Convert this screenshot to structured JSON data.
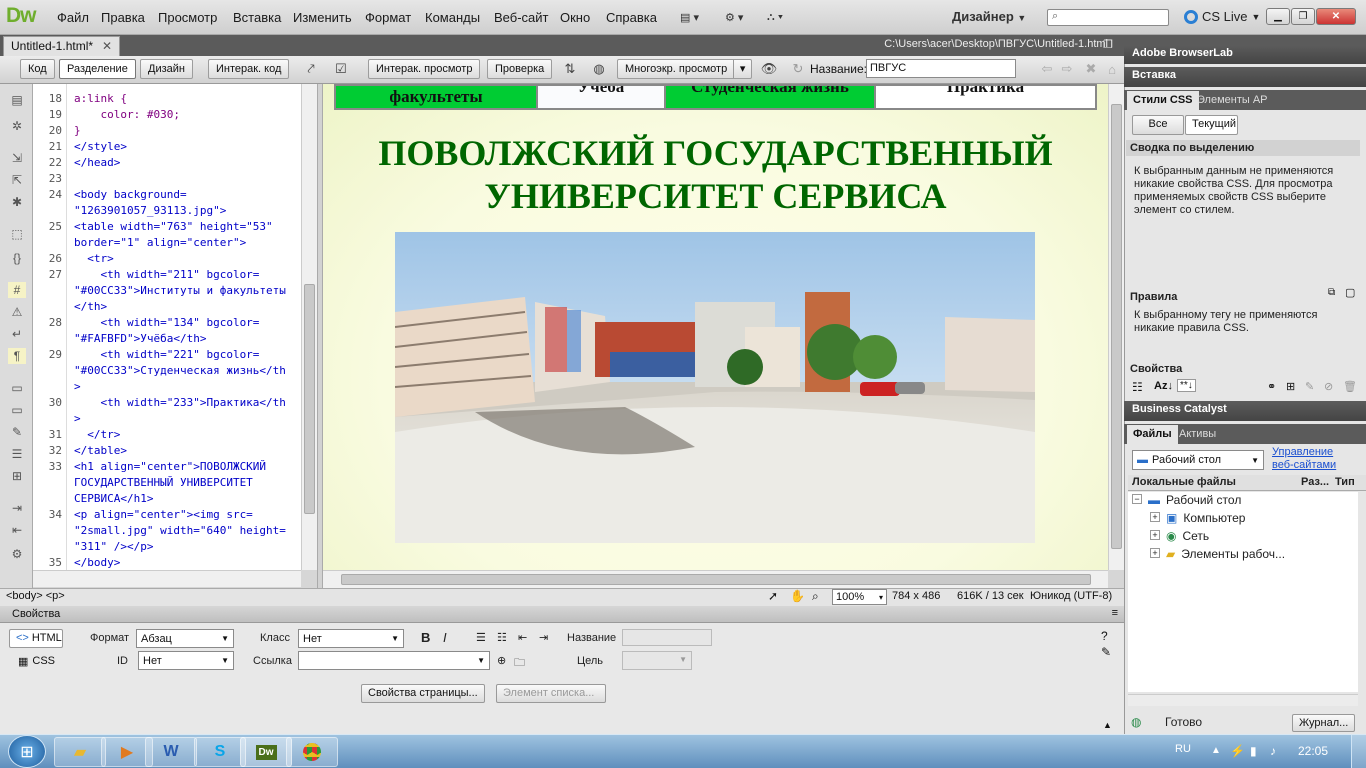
{
  "app": {
    "logo": "Dw"
  },
  "menu": [
    "Файл",
    "Правка",
    "Просмотр",
    "Вставка",
    "Изменить",
    "Формат",
    "Команды",
    "Веб-сайт",
    "Окно",
    "Справка"
  ],
  "workspace": {
    "label": "Дизайнер",
    "live": "CS Live"
  },
  "document": {
    "tab": "Untitled-1.html*",
    "path": "C:\\Users\\acer\\Desktop\\ПВГУС\\Untitled-1.html"
  },
  "toolbar": {
    "code": "Код",
    "split": "Разделение",
    "design": "Дизайн",
    "live_code": "Интерак. код",
    "live_view": "Интерак. просмотр",
    "inspect": "Проверка",
    "multiscreen": "Многоэкр. просмотр",
    "title_label": "Название:",
    "title_value": "ПВГУС"
  },
  "code": {
    "line_numbers": [
      "18",
      "19",
      "20",
      "21",
      "22",
      "23",
      "24",
      "",
      "25",
      "",
      "26",
      "27",
      "",
      "",
      "28",
      "",
      "29",
      "",
      "",
      "30",
      "",
      "31",
      "32",
      "33",
      "",
      "",
      "34",
      "",
      "",
      "35"
    ],
    "lines": [
      "a:link {",
      "    color: #030;",
      "}",
      "</style>",
      "</head>",
      "",
      "<body background=",
      "\"1263901057_93113.jpg\">",
      "<table width=\"763\" height=\"53\"",
      "border=\"1\" align=\"center\">",
      "  <tr>",
      "    <th width=\"211\" bgcolor=",
      "\"#00CC33\">Институты и факультеты",
      "</th>",
      "    <th width=\"134\" bgcolor=",
      "\"#FAFBFD\">Учёба</th>",
      "    <th width=\"221\" bgcolor=",
      "\"#00CC33\">Студенческая жизнь</th",
      ">",
      "    <th width=\"233\">Практика</th",
      ">",
      "  </tr>",
      "</table>",
      "<h1 align=\"center\">ПОВОЛЖСКИЙ",
      "ГОСУДАРСТВЕННЫЙ УНИВЕРСИТЕТ",
      "СЕРВИСА</h1>",
      "<p align=\"center\"><img src=",
      "\"2small.jpg\" width=\"640\" height=",
      "\"311\" /></p>",
      "</body>"
    ]
  },
  "design_view": {
    "nav": [
      {
        "label": "факультеты",
        "color": "#00CC33"
      },
      {
        "label": "Учёба",
        "color": "#FAFBFD"
      },
      {
        "label": "Студенческая жизнь",
        "color": "#00CC33"
      },
      {
        "label": "Практика",
        "color": "#FFFFFF"
      }
    ],
    "heading": "ПОВОЛЖСКИЙ ГОСУДАРСТВЕННЫЙ УНИВЕРСИТЕТ СЕРВИСА",
    "heading_color": "#006600"
  },
  "status": {
    "tags": "<body> <p>",
    "zoom": "100%",
    "size": "784 x 486",
    "weight": "616K / 13 сек",
    "encoding": "Юникод (UTF-8)"
  },
  "properties": {
    "title": "Свойства",
    "html": "HTML",
    "css": "CSS",
    "format_label": "Формат",
    "format_value": "Абзац",
    "class_label": "Класс",
    "class_value": "Нет",
    "id_label": "ID",
    "id_value": "Нет",
    "link_label": "Ссылка",
    "name_label": "Название",
    "target_label": "Цель",
    "page_props": "Свойства страницы...",
    "list_item": "Элемент списка..."
  },
  "right_panel": {
    "browserlab": "Adobe BrowserLab",
    "insert": "Вставка",
    "css_tab": "Стили CSS",
    "ap_tab": "Элементы AP",
    "all": "Все",
    "current": "Текущий",
    "summary_title": "Сводка по выделению",
    "summary_text": "К выбранным данным не применяются никакие свойства CSS.  Для просмотра применяемых свойств CSS выберите элемент со стилем.",
    "rules_title": "Правила",
    "rules_text": "К выбранному тегу не применяются никакие правила CSS.",
    "props_title": "Свойства",
    "az": "Az↓",
    "business": "Business Catalyst",
    "files_tab": "Файлы",
    "assets_tab": "Активы",
    "site_select": "Рабочий стол",
    "manage": "Управление веб-сайтами",
    "col_local": "Локальные файлы",
    "col_size": "Раз...",
    "col_type": "Тип",
    "tree": [
      "Рабочий стол",
      "Компьютер",
      "Сеть",
      "Элементы рабоч..."
    ],
    "ready": "Готово",
    "log": "Журнал..."
  },
  "taskbar": {
    "lang": "RU",
    "time": "22:05"
  }
}
